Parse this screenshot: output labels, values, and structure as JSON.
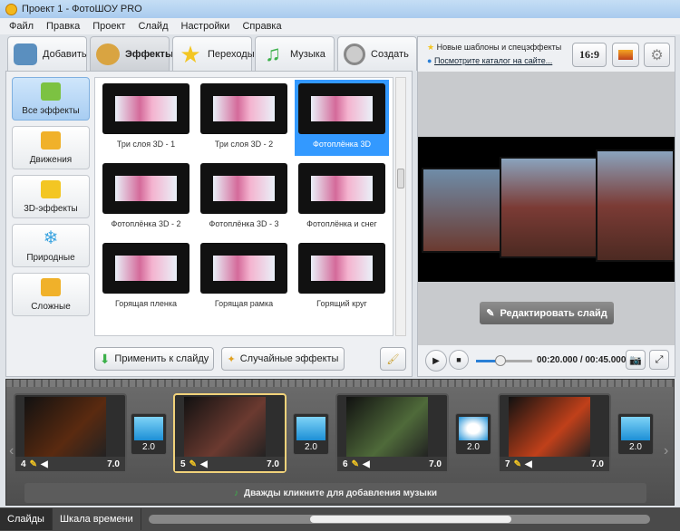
{
  "window": {
    "title": "Проект 1 - ФотоШОУ PRO"
  },
  "menu": [
    "Файл",
    "Правка",
    "Проект",
    "Слайд",
    "Настройки",
    "Справка"
  ],
  "tabs": [
    {
      "label": "Добавить",
      "color": "#5a8fbf"
    },
    {
      "label": "Эффекты",
      "color": "#d9a441"
    },
    {
      "label": "Переходы",
      "color": "#f3c623"
    },
    {
      "label": "Музыка",
      "color": "#3cb04a"
    },
    {
      "label": "Создать",
      "color": "#9a9a9a"
    }
  ],
  "categories": [
    {
      "label": "Все эффекты",
      "color": "#7cc242"
    },
    {
      "label": "Движения",
      "color": "#f0b12a"
    },
    {
      "label": "3D-эффекты",
      "color": "#f3c623"
    },
    {
      "label": "Природные",
      "color": "#3ba4e0"
    },
    {
      "label": "Сложные",
      "color": "#f0b12a"
    }
  ],
  "effects": [
    "Три слоя 3D - 1",
    "Три слоя 3D - 2",
    "Фотоплёнка 3D",
    "Фотоплёнка 3D - 2",
    "Фотоплёнка 3D - 3",
    "Фотоплёнка и снег",
    "Горящая пленка",
    "Горящая рамка",
    "Горящий круг"
  ],
  "selected_effect": "Фотоплёнка 3D",
  "actions": {
    "apply": "Применить к слайду",
    "random": "Случайные эффекты"
  },
  "info": {
    "news": "Новые шаблоны и спецэффекты",
    "catalog_link": "Посмотрите каталог на сайте...",
    "aspect": "16:9"
  },
  "preview": {
    "edit_button": "Редактировать слайд",
    "time": "00:20.000 / 00:45.000",
    "progress": 0.44
  },
  "slides": [
    {
      "num": "4",
      "duration": "7.0",
      "color": "#5a2a10"
    },
    {
      "num": "5",
      "duration": "7.0",
      "color": "#6b3a30"
    },
    {
      "num": "6",
      "duration": "7.0",
      "color": "#4f6a3a"
    },
    {
      "num": "7",
      "duration": "7.0",
      "color": "#c0401a"
    }
  ],
  "transitions": [
    "2.0",
    "2.0",
    "2.0",
    "2.0"
  ],
  "music_hint": "Дважды кликните для добавления музыки",
  "bottom_tabs": [
    "Слайды",
    "Шкала времени"
  ]
}
